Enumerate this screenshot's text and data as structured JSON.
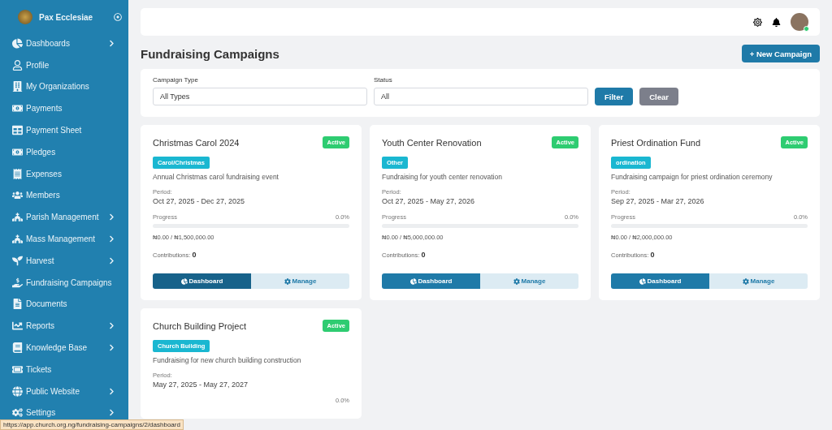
{
  "sidebar": {
    "org_name": "Pax Ecclesiae",
    "items": [
      {
        "label": "Dashboards",
        "expandable": true
      },
      {
        "label": "Profile",
        "expandable": false
      },
      {
        "label": "My Organizations",
        "expandable": false
      },
      {
        "label": "Payments",
        "expandable": false
      },
      {
        "label": "Payment Sheet",
        "expandable": false
      },
      {
        "label": "Pledges",
        "expandable": false
      },
      {
        "label": "Expenses",
        "expandable": false
      },
      {
        "label": "Members",
        "expandable": false
      },
      {
        "label": "Parish Management",
        "expandable": true
      },
      {
        "label": "Mass Management",
        "expandable": true
      },
      {
        "label": "Harvest",
        "expandable": true
      },
      {
        "label": "Fundraising Campaigns",
        "expandable": false
      },
      {
        "label": "Documents",
        "expandable": false
      },
      {
        "label": "Reports",
        "expandable": true
      },
      {
        "label": "Knowledge Base",
        "expandable": true
      },
      {
        "label": "Tickets",
        "expandable": false
      },
      {
        "label": "Public Website",
        "expandable": true
      },
      {
        "label": "Settings",
        "expandable": true
      }
    ]
  },
  "header": {
    "user_online": true
  },
  "page_title": "Fundraising Campaigns",
  "new_button": "+ New Campaign",
  "filters": {
    "fields": [
      {
        "label": "Campaign Type",
        "value": "All Types"
      },
      {
        "label": "Status",
        "value": "All"
      }
    ],
    "filter_button": "Filter",
    "clear_button": "Clear"
  },
  "campaigns": [
    {
      "title": "Christmas Carol 2024",
      "status": "Active",
      "category": "Carol/Christmas",
      "description": "Annual Christmas carol fundraising event",
      "period_label": "Period:",
      "period": "Oct 27, 2025 - Dec 27, 2025",
      "progress_label": "Progress",
      "progress_percent": "0.0%",
      "amount": "₦0.00 / ₦1,500,000.00",
      "contributions_label": "Contributions:",
      "contributions": "0",
      "dashboard_button": "Dashboard",
      "manage_button": "Manage",
      "dashboard_hovered": true
    },
    {
      "title": "Youth Center Renovation",
      "status": "Active",
      "category": "Other",
      "description": "Fundraising for youth center renovation",
      "period_label": "Period:",
      "period": "Oct 27, 2025 - May 27, 2026",
      "progress_label": "Progress",
      "progress_percent": "0.0%",
      "amount": "₦0.00 / ₦5,000,000.00",
      "contributions_label": "Contributions:",
      "contributions": "0",
      "dashboard_button": "Dashboard",
      "manage_button": "Manage",
      "dashboard_hovered": false
    },
    {
      "title": "Priest Ordination Fund",
      "status": "Active",
      "category": "ordination",
      "description": "Fundraising campaign for priest ordination ceremony",
      "period_label": "Period:",
      "period": "Sep 27, 2025 - Mar 27, 2026",
      "progress_label": "Progress",
      "progress_percent": "0.0%",
      "amount": "₦0.00 / ₦2,000,000.00",
      "contributions_label": "Contributions:",
      "contributions": "0",
      "dashboard_button": "Dashboard",
      "manage_button": "Manage",
      "dashboard_hovered": false
    },
    {
      "title": "Church Building Project",
      "status": "Active",
      "category": "Church Building",
      "description": "Fundraising for new church building construction",
      "period_label": "Period:",
      "period": "May 27, 2025 - May 27, 2027",
      "progress_percent": "0.0%"
    }
  ],
  "status_url": "https://app.church.org.ng/fundraising-campaigns/2/dashboard"
}
